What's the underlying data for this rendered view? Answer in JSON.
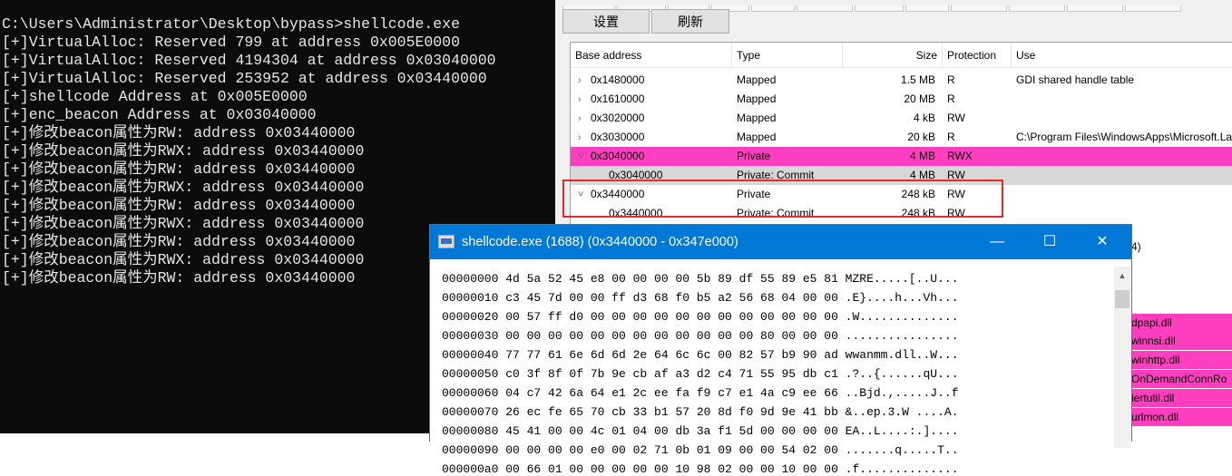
{
  "console": {
    "lines": [
      "C:\\Users\\Administrator\\Desktop\\bypass>shellcode.exe",
      "[+]VirtualAlloc: Reserved 799 at address 0x005E0000",
      "[+]VirtualAlloc: Reserved 4194304 at address 0x03040000",
      "[+]VirtualAlloc: Reserved 253952 at address 0x03440000",
      "[+]shellcode Address at 0x005E0000",
      "[+]enc_beacon Address at 0x03040000",
      "[+]修改beacon属性为RW: address 0x03440000",
      "[+]修改beacon属性为RWX: address 0x03440000",
      "[+]修改beacon属性为RW: address 0x03440000",
      "[+]修改beacon属性为RWX: address 0x03440000",
      "[+]修改beacon属性为RW: address 0x03440000",
      "[+]修改beacon属性为RWX: address 0x03440000",
      "[+]修改beacon属性为RW: address 0x03440000",
      "[+]修改beacon属性为RWX: address 0x03440000",
      "[+]修改beacon属性为RW: address 0x03440000"
    ]
  },
  "memory": {
    "toolbar": {
      "settings": "设置",
      "refresh": "刷新"
    },
    "columns": [
      "Base address",
      "Type",
      "Size",
      "Protection",
      "Use"
    ],
    "rows": [
      {
        "chev": "›",
        "base": "0x1480000",
        "type": "Mapped",
        "size": "1.5 MB",
        "prot": "R",
        "use": "GDI shared handle table",
        "style": ""
      },
      {
        "chev": "›",
        "base": "0x1610000",
        "type": "Mapped",
        "size": "20 MB",
        "prot": "R",
        "use": "",
        "style": ""
      },
      {
        "chev": "›",
        "base": "0x3020000",
        "type": "Mapped",
        "size": "4 kB",
        "prot": "RW",
        "use": "",
        "style": ""
      },
      {
        "chev": "›",
        "base": "0x3030000",
        "type": "Mapped",
        "size": "20 kB",
        "prot": "R",
        "use": "C:\\Program Files\\WindowsApps\\Microsoft.La",
        "style": ""
      },
      {
        "chev": "˅",
        "base": "0x3040000",
        "type": "Private",
        "size": "4 MB",
        "prot": "RWX",
        "use": "",
        "style": "pink"
      },
      {
        "chev": "",
        "base": "0x3040000",
        "type": "Private: Commit",
        "size": "4 MB",
        "prot": "RW",
        "use": "",
        "style": "grey"
      },
      {
        "chev": "˅",
        "base": "0x3440000",
        "type": "Private",
        "size": "248 kB",
        "prot": "RW",
        "use": "",
        "style": ""
      },
      {
        "chev": "",
        "base": "0x3440000",
        "type": "Private: Commit",
        "size": "248 kB",
        "prot": "RW",
        "use": "",
        "style": ""
      }
    ],
    "side_items": [
      {
        "text": "4)",
        "style": ""
      },
      {
        "text": "dpapi.dll",
        "style": "pink"
      },
      {
        "text": "winnsi.dll",
        "style": "pink"
      },
      {
        "text": "winhttp.dll",
        "style": "pink"
      },
      {
        "text": "OnDemandConnRo",
        "style": "pink"
      },
      {
        "text": "iertutil.dll",
        "style": "pink"
      },
      {
        "text": "urlmon.dll",
        "style": "pink"
      }
    ]
  },
  "hexwin": {
    "title": "shellcode.exe (1688) (0x3440000 - 0x347e000)",
    "lines": [
      "00000000 4d 5a 52 45 e8 00 00 00 00 5b 89 df 55 89 e5 81 MZRE.....[..U...",
      "00000010 c3 45 7d 00 00 ff d3 68 f0 b5 a2 56 68 04 00 00 .E}....h...Vh...",
      "00000020 00 57 ff d0 00 00 00 00 00 00 00 00 00 00 00 00 .W..............",
      "00000030 00 00 00 00 00 00 00 00 00 00 00 00 80 00 00 00 ................",
      "00000040 77 77 61 6e 6d 6d 2e 64 6c 6c 00 82 57 b9 90 ad wwanmm.dll..W...",
      "00000050 c0 3f 8f 0f 7b 9e cb af a3 d2 c4 71 55 95 db c1 .?..{......qU...",
      "00000060 04 c7 42 6a 64 e1 2c ee fa f9 c7 e1 4a c9 ee 66 ..Bjd.,.....J..f",
      "00000070 26 ec fe 65 70 cb 33 b1 57 20 8d f0 9d 9e 41 bb &..ep.3.W ....A.",
      "00000080 45 41 00 00 4c 01 04 00 db 3a f1 5d 00 00 00 00 EA..L....:.]....",
      "00000090 00 00 00 00 e0 00 02 71 0b 01 09 00 00 54 02 00 .......q.....T..",
      "000000a0 00 66 01 00 00 00 00 00 10 98 02 00 00 10 00 00 .f.............."
    ]
  },
  "colors": {
    "accent": "#0078d7",
    "pink": "#ff3fbf",
    "highlight": "#e32b2b"
  }
}
